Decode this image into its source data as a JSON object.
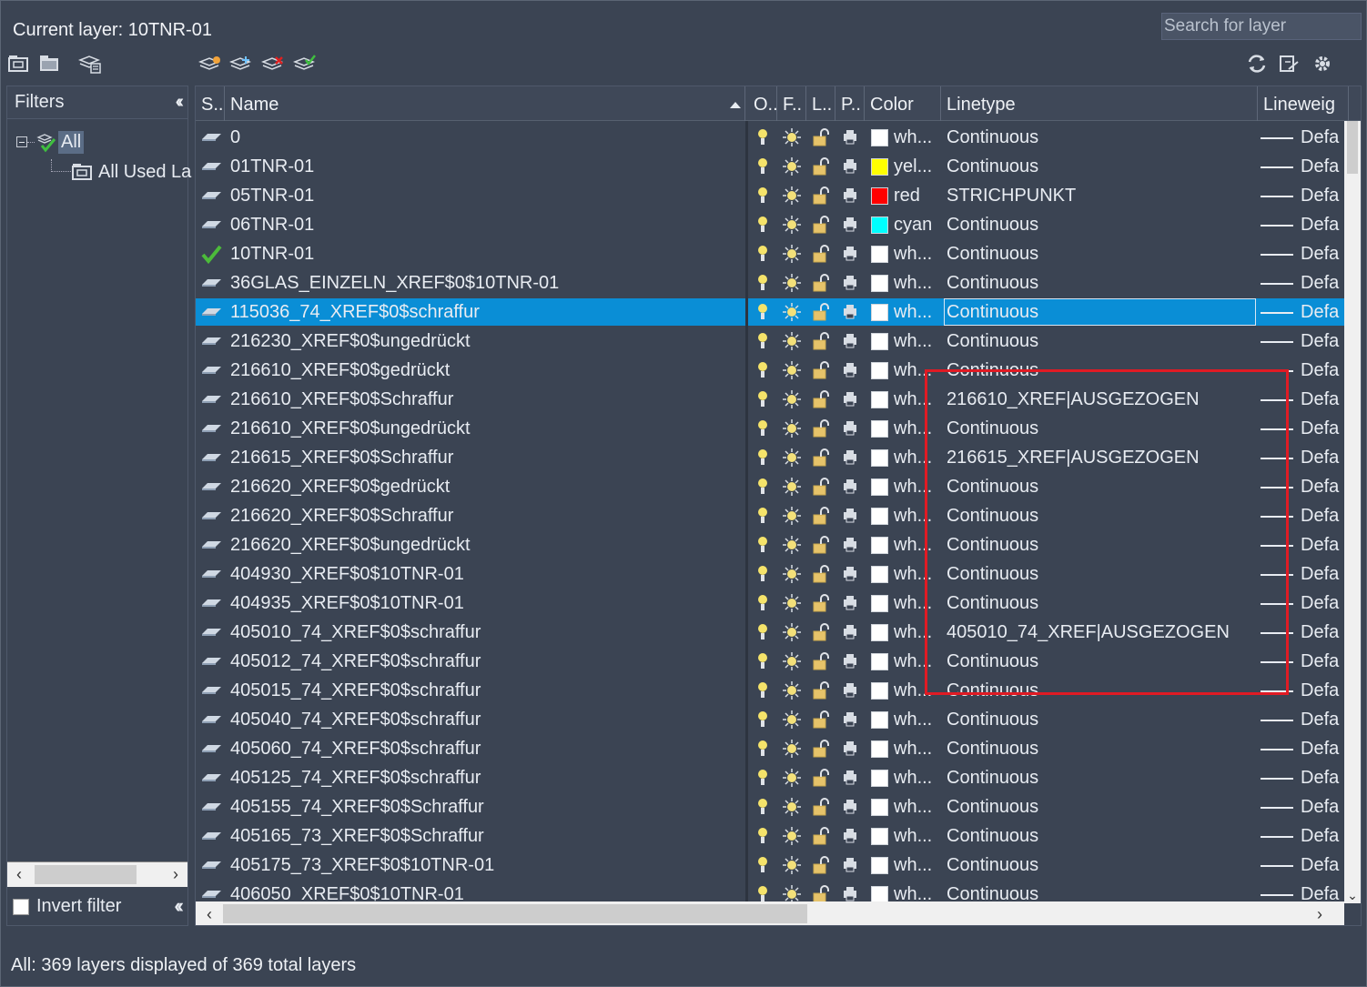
{
  "header": {
    "current_layer_label": "Current layer: 10TNR-01",
    "search_placeholder": "Search for layer"
  },
  "filters": {
    "title": "Filters",
    "tree": [
      {
        "label": "All"
      },
      {
        "label": "All Used La"
      }
    ],
    "invert_filter_label": "Invert filter"
  },
  "table": {
    "columns": [
      {
        "key": "status",
        "label": "S.."
      },
      {
        "key": "name",
        "label": "Name"
      },
      {
        "key": "on",
        "label": "O.."
      },
      {
        "key": "freeze",
        "label": "F.."
      },
      {
        "key": "lock",
        "label": "L.."
      },
      {
        "key": "plot",
        "label": "P.."
      },
      {
        "key": "color",
        "label": "Color"
      },
      {
        "key": "linetype",
        "label": "Linetype"
      },
      {
        "key": "lineweight",
        "label": "Lineweig"
      }
    ],
    "rows": [
      {
        "name": "0",
        "color": "wh...",
        "color_hex": "#ffffff",
        "linetype": "Continuous",
        "lineweight": "Defa"
      },
      {
        "name": "01TNR-01",
        "color": "yel...",
        "color_hex": "#ffff00",
        "linetype": "Continuous",
        "lineweight": "Defa"
      },
      {
        "name": "05TNR-01",
        "color": "red",
        "color_hex": "#ff0000",
        "linetype": "STRICHPUNKT",
        "lineweight": "Defa"
      },
      {
        "name": "06TNR-01",
        "color": "cyan",
        "color_hex": "#00ffff",
        "linetype": "Continuous",
        "lineweight": "Defa"
      },
      {
        "name": "10TNR-01",
        "current": true,
        "color": "wh...",
        "color_hex": "#ffffff",
        "linetype": "Continuous",
        "lineweight": "Defa"
      },
      {
        "name": "36GLAS_EINZELN_XREF$0$10TNR-01",
        "color": "wh...",
        "color_hex": "#ffffff",
        "linetype": "Continuous",
        "lineweight": "Defa"
      },
      {
        "name": "115036_74_XREF$0$schraffur",
        "selected": true,
        "color": "wh...",
        "color_hex": "#ffffff",
        "linetype": "Continuous",
        "lineweight": "Defa"
      },
      {
        "name": "216230_XREF$0$ungedrückt",
        "color": "wh...",
        "color_hex": "#ffffff",
        "linetype": "Continuous",
        "lineweight": "Defa"
      },
      {
        "name": "216610_XREF$0$gedrückt",
        "color": "wh...",
        "color_hex": "#ffffff",
        "linetype": "Continuous",
        "lineweight": "Defa"
      },
      {
        "name": "216610_XREF$0$Schraffur",
        "color": "wh...",
        "color_hex": "#ffffff",
        "linetype": "216610_XREF|AUSGEZOGEN",
        "lineweight": "Defa"
      },
      {
        "name": "216610_XREF$0$ungedrückt",
        "color": "wh...",
        "color_hex": "#ffffff",
        "linetype": "Continuous",
        "lineweight": "Defa"
      },
      {
        "name": "216615_XREF$0$Schraffur",
        "color": "wh...",
        "color_hex": "#ffffff",
        "linetype": "216615_XREF|AUSGEZOGEN",
        "lineweight": "Defa"
      },
      {
        "name": "216620_XREF$0$gedrückt",
        "color": "wh...",
        "color_hex": "#ffffff",
        "linetype": "Continuous",
        "lineweight": "Defa"
      },
      {
        "name": "216620_XREF$0$Schraffur",
        "color": "wh...",
        "color_hex": "#ffffff",
        "linetype": "Continuous",
        "lineweight": "Defa"
      },
      {
        "name": "216620_XREF$0$ungedrückt",
        "color": "wh...",
        "color_hex": "#ffffff",
        "linetype": "Continuous",
        "lineweight": "Defa"
      },
      {
        "name": "404930_XREF$0$10TNR-01",
        "color": "wh...",
        "color_hex": "#ffffff",
        "linetype": "Continuous",
        "lineweight": "Defa"
      },
      {
        "name": "404935_XREF$0$10TNR-01",
        "color": "wh...",
        "color_hex": "#ffffff",
        "linetype": "Continuous",
        "lineweight": "Defa"
      },
      {
        "name": "405010_74_XREF$0$schraffur",
        "color": "wh...",
        "color_hex": "#ffffff",
        "linetype": "405010_74_XREF|AUSGEZOGEN",
        "lineweight": "Defa"
      },
      {
        "name": "405012_74_XREF$0$schraffur",
        "color": "wh...",
        "color_hex": "#ffffff",
        "linetype": "Continuous",
        "lineweight": "Defa"
      },
      {
        "name": "405015_74_XREF$0$schraffur",
        "color": "wh...",
        "color_hex": "#ffffff",
        "linetype": "Continuous",
        "lineweight": "Defa"
      },
      {
        "name": "405040_74_XREF$0$schraffur",
        "color": "wh...",
        "color_hex": "#ffffff",
        "linetype": "Continuous",
        "lineweight": "Defa"
      },
      {
        "name": "405060_74_XREF$0$schraffur",
        "color": "wh...",
        "color_hex": "#ffffff",
        "linetype": "Continuous",
        "lineweight": "Defa"
      },
      {
        "name": "405125_74_XREF$0$schraffur",
        "color": "wh...",
        "color_hex": "#ffffff",
        "linetype": "Continuous",
        "lineweight": "Defa"
      },
      {
        "name": "405155_74_XREF$0$Schraffur",
        "color": "wh...",
        "color_hex": "#ffffff",
        "linetype": "Continuous",
        "lineweight": "Defa"
      },
      {
        "name": "405165_73_XREF$0$Schraffur",
        "color": "wh...",
        "color_hex": "#ffffff",
        "linetype": "Continuous",
        "lineweight": "Defa"
      },
      {
        "name": "405175_73_XREF$0$10TNR-01",
        "color": "wh...",
        "color_hex": "#ffffff",
        "linetype": "Continuous",
        "lineweight": "Defa"
      },
      {
        "name": "406050_XREF$0$10TNR-01",
        "color": "wh...",
        "color_hex": "#ffffff",
        "linetype": "Continuous",
        "lineweight": "Defa"
      }
    ]
  },
  "status_bar": {
    "text": "All: 369 layers displayed of 369 total layers"
  },
  "colors": {
    "background": "#3b4453",
    "selection": "#0a8ed6",
    "highlight_rect": "#e01b24"
  }
}
